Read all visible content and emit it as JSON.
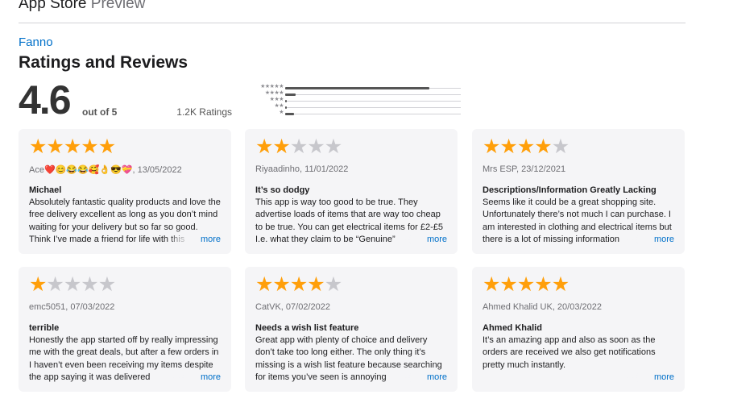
{
  "header": {
    "brand": "App Store",
    "sub": "Preview"
  },
  "app_name": "Fanno",
  "section_title": "Ratings and Reviews",
  "summary": {
    "average": "4.6",
    "out_of": "out of 5",
    "count": "1.2K Ratings"
  },
  "histogram": [
    {
      "stars": "★★★★★",
      "fraction": 0.82
    },
    {
      "stars": "★★★★",
      "fraction": 0.06
    },
    {
      "stars": "★★★",
      "fraction": 0.01
    },
    {
      "stars": "★★",
      "fraction": 0.01
    },
    {
      "stars": "★",
      "fraction": 0.05
    }
  ],
  "more_label": "more",
  "reviews": [
    {
      "rating": 5,
      "author": "Ace❤️😊😂😂🥰👌😎💝, 13/05/2022",
      "title": "Michael",
      "body": "Absolutely fantastic quality products and love the free delivery excellent as long as you don’t mind waiting for your delivery but so far so good. Think I’ve made a friend for life with this app",
      "more": true
    },
    {
      "rating": 2,
      "author": "Riyaadinho, 11/01/2022",
      "title": "It’s so dodgy",
      "body": "This app is way too good to be true. They advertise loads of items that are way too cheap to be true. You can get electrical items for £2-£5 I.e. what they claim to be “Genuine”",
      "more": true
    },
    {
      "rating": 4,
      "author": "Mrs ESP, 23/12/2021",
      "title": "Descriptions/Information Greatly Lacking",
      "body": "Seems like it could be a great shopping site. Unfortunately there’s not much I can purchase. I am interested in clothing and electrical items but there is a lot of missing information",
      "more": true
    },
    {
      "rating": 1,
      "author": "emc5051, 07/03/2022",
      "title": "terrible",
      "body": "Honestly the app started off by really impressing me with the great deals, but after a few orders in I haven’t even been receiving my items despite the app saying it was delivered",
      "more": true
    },
    {
      "rating": 4,
      "author": "CatVK, 07/02/2022",
      "title": "Needs a wish list feature",
      "body": "Great app with plenty of choice and delivery don’t take too long either. The only thing it’s missing is a wish list feature because searching for items you’ve seen is annoying",
      "more": true
    },
    {
      "rating": 5,
      "author": "Ahmed Khalid UK, 20/03/2022",
      "title": "Ahmed Khalid",
      "body": "It’s an amazing app and also as soon as the orders are received we also get notifications pretty much instantly.",
      "more": true
    }
  ],
  "colors": {
    "star_on": "#ff9f0a",
    "star_off": "#c7c7cc",
    "link": "#0070c9",
    "card_bg": "#f5f5f7"
  }
}
